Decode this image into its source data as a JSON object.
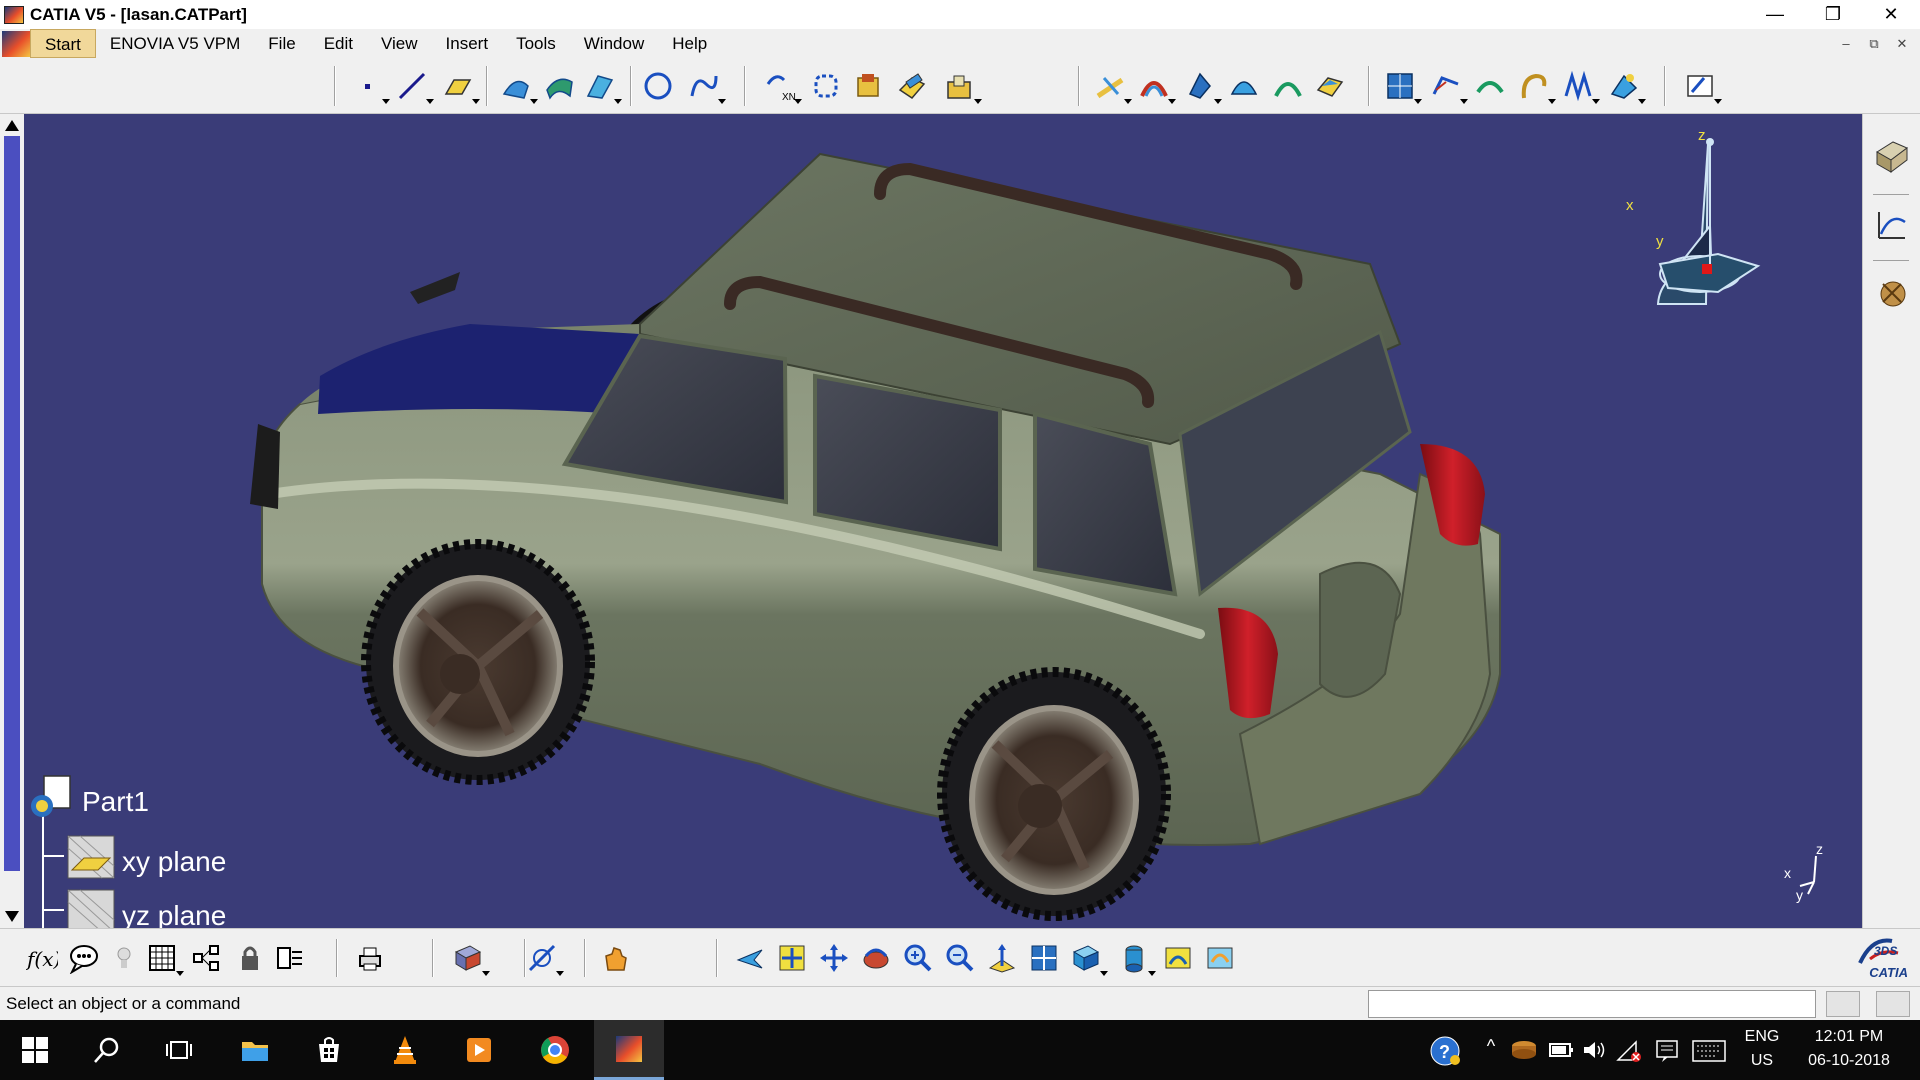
{
  "window": {
    "title": "CATIA V5 - [lasan.CATPart]",
    "controls": {
      "minimize": "—",
      "restore": "❐",
      "close": "✕"
    },
    "mdi_controls": {
      "minimize": "–",
      "restore": "⧉",
      "close": "✕"
    }
  },
  "menu": {
    "items": [
      "Start",
      "ENOVIA V5 VPM",
      "File",
      "Edit",
      "View",
      "Insert",
      "Tools",
      "Window",
      "Help"
    ]
  },
  "tree": {
    "root": {
      "label": "Part1",
      "icon": "part-icon"
    },
    "children": [
      {
        "label": "xy plane",
        "icon": "plane-icon"
      },
      {
        "label": "yz plane",
        "icon": "plane-icon"
      }
    ]
  },
  "compass": {
    "x_label": "x",
    "y_label": "y",
    "z_label": "z"
  },
  "axis_triad": {
    "x_label": "x",
    "y_label": "y",
    "z_label": "z"
  },
  "status": {
    "message": "Select an object or a command",
    "command_input": ""
  },
  "brand": {
    "name": "CATIA",
    "mark": "3DS"
  },
  "taskbar": {
    "tray": {
      "language": "ENG",
      "region": "US",
      "time": "12:01 PM",
      "date": "06-10-2018"
    }
  },
  "colors": {
    "viewport_bg": "#3a3c78",
    "car_body": "#7c8670",
    "taillight": "#b01820",
    "hood_stripe": "#1c2270",
    "start_menu": "#f1d89a"
  }
}
